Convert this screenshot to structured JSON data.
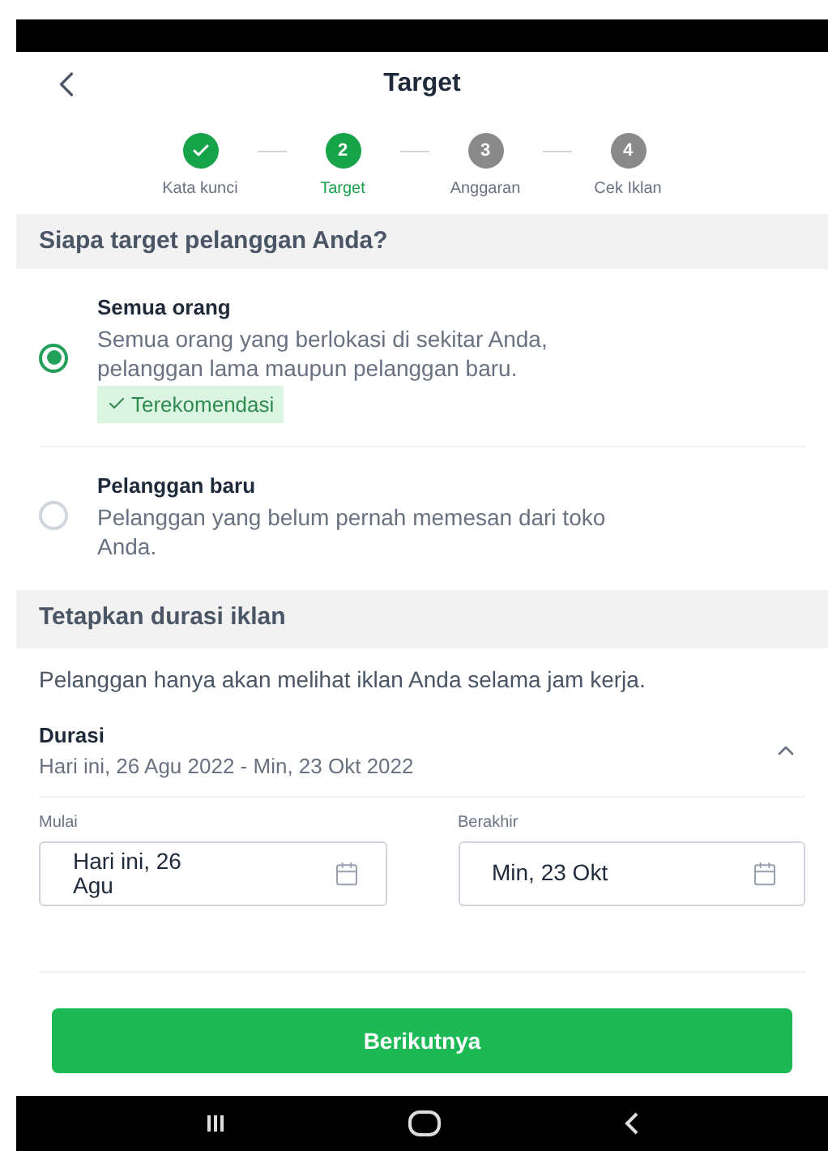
{
  "header": {
    "title": "Target"
  },
  "steps": [
    {
      "label": "Kata kunci",
      "done": true,
      "selected": false
    },
    {
      "label": "Target",
      "number": "2",
      "done": false,
      "selected": true
    },
    {
      "label": "Anggaran",
      "number": "3",
      "done": false,
      "selected": false
    },
    {
      "label": "Cek Iklan",
      "number": "4",
      "done": false,
      "selected": false
    }
  ],
  "audience": {
    "heading": "Siapa target pelanggan Anda?",
    "options": [
      {
        "title": "Semua orang",
        "description": "Semua orang yang berlokasi di sekitar Anda, pelanggan lama maupun pelanggan baru.",
        "badge": "Terekomendasi",
        "selected": true
      },
      {
        "title": "Pelanggan baru",
        "description": "Pelanggan yang belum pernah memesan dari toko Anda.",
        "selected": false
      }
    ]
  },
  "duration": {
    "heading": "Tetapkan durasi iklan",
    "note": "Pelanggan hanya akan melihat iklan Anda selama jam kerja.",
    "label": "Durasi",
    "range": "Hari ini, 26 Agu 2022 - Min, 23 Okt 2022",
    "expanded": true,
    "fields": [
      {
        "label": "Mulai",
        "value": "Hari ini, 26 Agu"
      },
      {
        "label": "Berakhir",
        "value": "Min, 23 Okt"
      }
    ]
  },
  "next_button": "Berikutnya"
}
